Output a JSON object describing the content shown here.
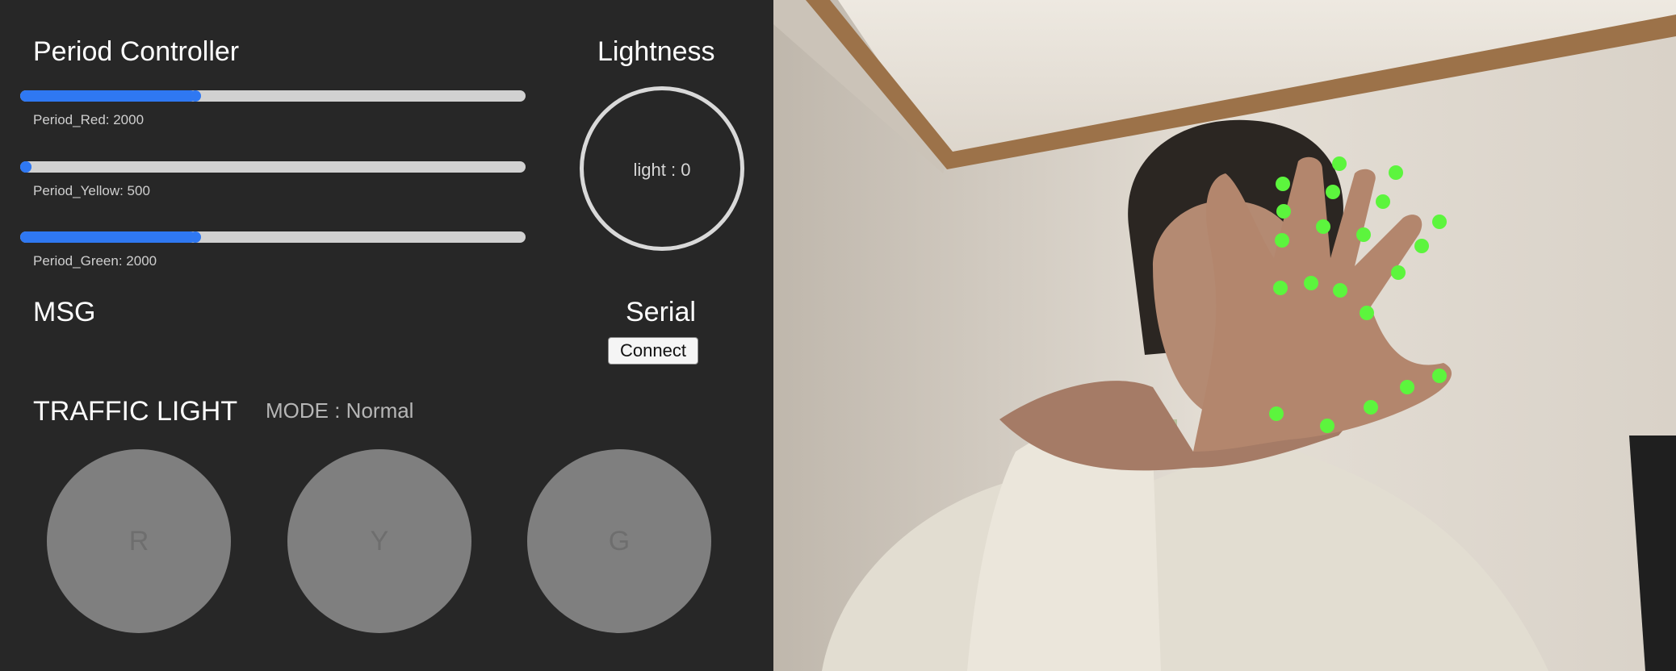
{
  "controller": {
    "title": "Period Controller",
    "sliders": [
      {
        "label": "Period_Red: 2000",
        "value_fraction": 0.345
      },
      {
        "label": "Period_Yellow: 500",
        "value_fraction": 0.0
      },
      {
        "label": "Period_Green: 2000",
        "value_fraction": 0.345
      }
    ]
  },
  "lightness": {
    "title": "Lightness",
    "text": "light : 0"
  },
  "msg": {
    "title": "MSG"
  },
  "serial": {
    "title": "Serial",
    "connect_label": "Connect"
  },
  "traffic": {
    "title": "TRAFFIC LIGHT",
    "mode": "MODE : Normal",
    "lights": [
      {
        "label": "R"
      },
      {
        "label": "Y"
      },
      {
        "label": "G"
      }
    ]
  },
  "colors": {
    "accent": "#2f78f2",
    "track": "#d1d1d1",
    "lamp_off": "#7f7f7f",
    "landmark": "#5cf53d",
    "panel_bg": "#272727"
  },
  "camera": {
    "landmark_count": 21
  }
}
